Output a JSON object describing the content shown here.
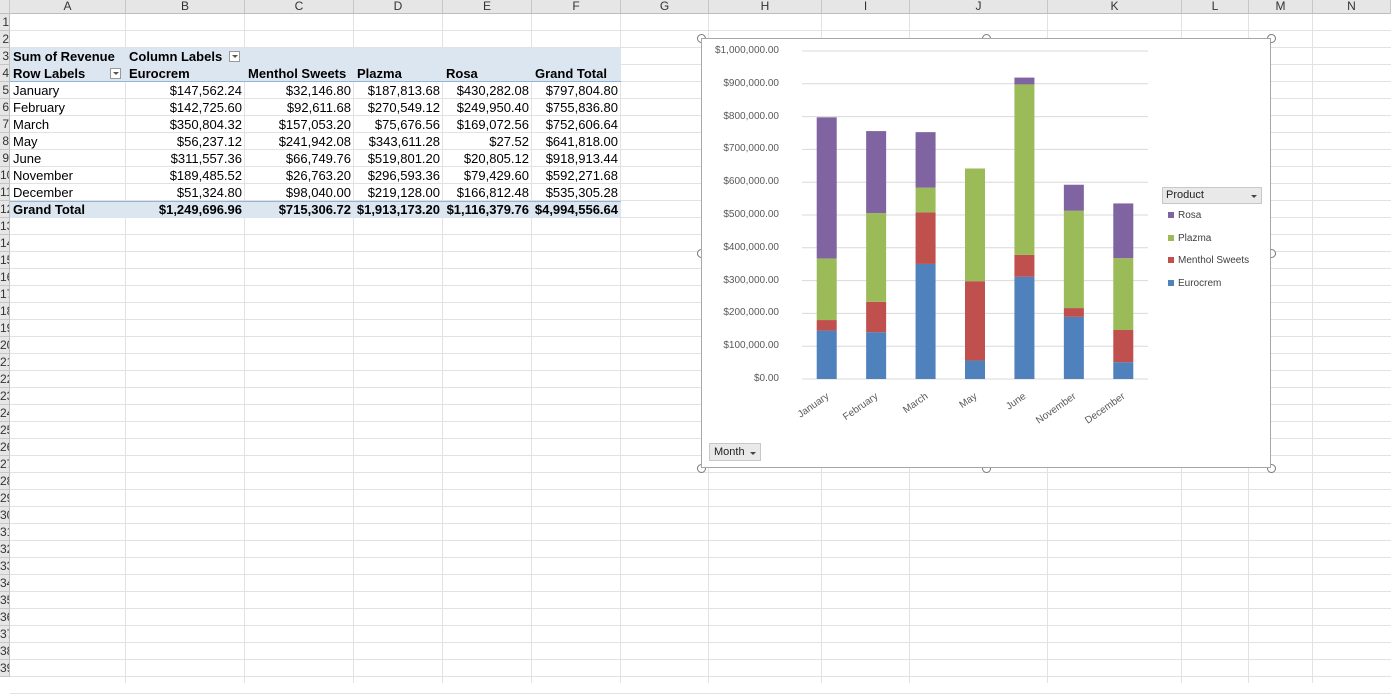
{
  "columns": [
    "A",
    "B",
    "C",
    "D",
    "E",
    "F",
    "G",
    "H",
    "I",
    "J",
    "K",
    "L",
    "M",
    "N"
  ],
  "row_numbers": [
    "1",
    "2",
    "3",
    "4",
    "5",
    "6",
    "7",
    "8",
    "9",
    "10",
    "11",
    "12",
    "13",
    "14",
    "15",
    "16",
    "17",
    "18",
    "19",
    "20",
    "21",
    "22",
    "23",
    "24",
    "25",
    "26",
    "27",
    "28",
    "29",
    "30",
    "31",
    "32",
    "33",
    "34",
    "35",
    "36",
    "37",
    "38",
    "39"
  ],
  "pivot": {
    "values_label": "Sum of Revenue",
    "column_labels": "Column Labels",
    "row_labels": "Row Labels",
    "headers": [
      "Eurocrem",
      "Menthol Sweets",
      "Plazma",
      "Rosa",
      "Grand Total"
    ],
    "rows": [
      {
        "label": "January",
        "cells": [
          "$147,562.24",
          "$32,146.80",
          "$187,813.68",
          "$430,282.08",
          "$797,804.80"
        ]
      },
      {
        "label": "February",
        "cells": [
          "$142,725.60",
          "$92,611.68",
          "$270,549.12",
          "$249,950.40",
          "$755,836.80"
        ]
      },
      {
        "label": "March",
        "cells": [
          "$350,804.32",
          "$157,053.20",
          "$75,676.56",
          "$169,072.56",
          "$752,606.64"
        ]
      },
      {
        "label": "May",
        "cells": [
          "$56,237.12",
          "$241,942.08",
          "$343,611.28",
          "$27.52",
          "$641,818.00"
        ]
      },
      {
        "label": "June",
        "cells": [
          "$311,557.36",
          "$66,749.76",
          "$519,801.20",
          "$20,805.12",
          "$918,913.44"
        ]
      },
      {
        "label": "November",
        "cells": [
          "$189,485.52",
          "$26,763.20",
          "$296,593.36",
          "$79,429.60",
          "$592,271.68"
        ]
      },
      {
        "label": "December",
        "cells": [
          "$51,324.80",
          "$98,040.00",
          "$219,128.00",
          "$166,812.48",
          "$535,305.28"
        ]
      }
    ],
    "total": {
      "label": "Grand Total",
      "cells": [
        "$1,249,696.96",
        "$715,306.72",
        "$1,913,173.20",
        "$1,116,379.76",
        "$4,994,556.64"
      ]
    }
  },
  "chart_data": {
    "type": "bar",
    "stacked": true,
    "categories": [
      "January",
      "February",
      "March",
      "May",
      "June",
      "November",
      "December"
    ],
    "series": [
      {
        "name": "Eurocrem",
        "color": "#4f81bd",
        "values": [
          147562.24,
          142725.6,
          350804.32,
          56237.12,
          311557.36,
          189485.52,
          51324.8
        ]
      },
      {
        "name": "Menthol Sweets",
        "color": "#c0504d",
        "values": [
          32146.8,
          92611.68,
          157053.2,
          241942.08,
          66749.76,
          26763.2,
          98040.0
        ]
      },
      {
        "name": "Plazma",
        "color": "#9bbb59",
        "values": [
          187813.68,
          270549.12,
          75676.56,
          343611.28,
          519801.2,
          296593.36,
          219128.0
        ]
      },
      {
        "name": "Rosa",
        "color": "#8064a2",
        "values": [
          430282.08,
          249950.4,
          169072.56,
          27.52,
          20805.12,
          79429.6,
          166812.48
        ]
      }
    ],
    "y_ticks": [
      "$0.00",
      "$100,000.00",
      "$200,000.00",
      "$300,000.00",
      "$400,000.00",
      "$500,000.00",
      "$600,000.00",
      "$700,000.00",
      "$800,000.00",
      "$900,000.00",
      "$1,000,000.00"
    ],
    "ylim": [
      0,
      1000000
    ],
    "grid": true,
    "legend_title": "Product",
    "legend_order": [
      "Rosa",
      "Plazma",
      "Menthol Sweets",
      "Eurocrem"
    ],
    "legend_position": "right",
    "axis_field_button": "Month"
  }
}
